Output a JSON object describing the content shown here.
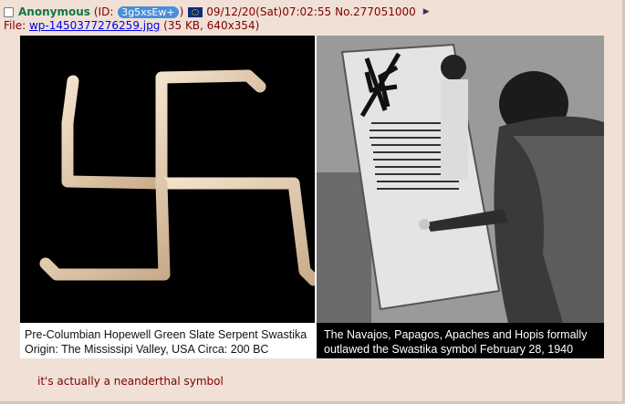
{
  "post": {
    "name": "Anonymous",
    "id_prefix": "(ID: ",
    "id": "3g5xsEw+",
    "id_suffix": ")",
    "datetime": "09/12/20(Sat)07:02:55",
    "number": "No.277051000",
    "menu_icon": "triangle-right-icon",
    "file_label": "File: ",
    "file_name": "wp-1450377276259.jpg",
    "file_meta": "(35 KB, 640x354)",
    "comment": "it's actually a neanderthal symbol"
  },
  "image": {
    "left_caption_line1": "Pre-Columbian Hopewell Green Slate Serpent Swastika",
    "left_caption_line2": "Origin:   The Mississipi Valley, USA   Circa: 200 BC",
    "right_caption_line1": "The Navajos, Papagos, Apaches and Hopis formally",
    "right_caption_line2": "outlawed the Swastika symbol February 28, 1940"
  },
  "colors": {
    "name": "#117743",
    "text": "#800000",
    "link": "#0000ee",
    "post_bg": "#f0e0d6",
    "id_badge": "#4a90d9"
  }
}
